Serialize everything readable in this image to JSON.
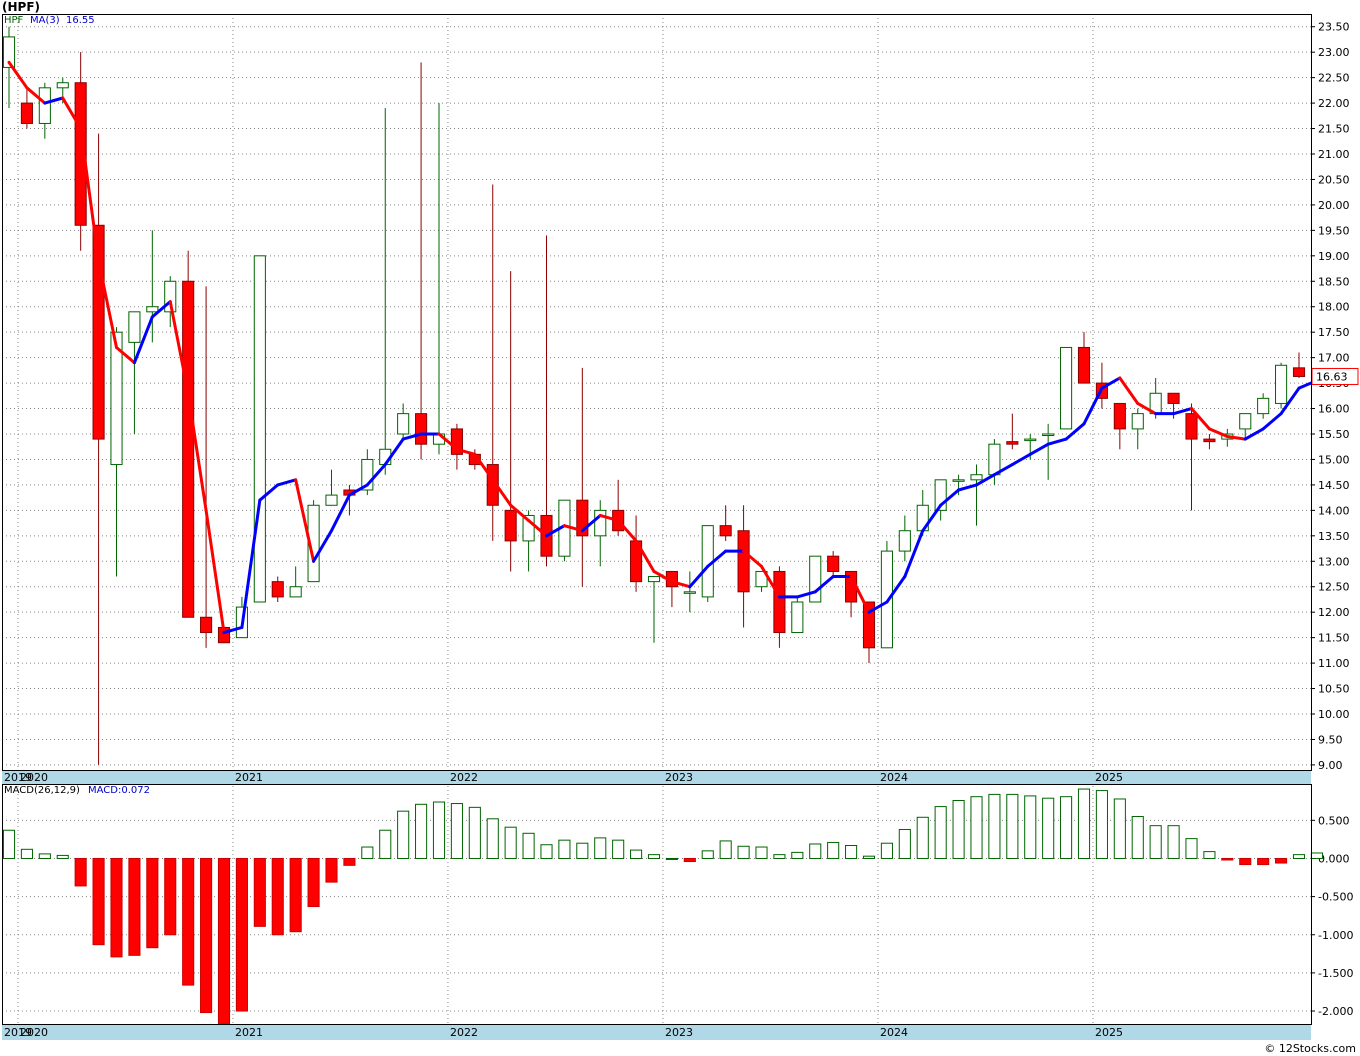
{
  "header": {
    "symbol_title": "(HPF)",
    "price_legend": "HPF",
    "ma_legend": "MA(3)",
    "ma_value": "16.55",
    "macd_legend": "MACD(26,12,9)",
    "macd_value_legend": "MACD:0.072"
  },
  "footer": {
    "credit": "© 12Stocks.com"
  },
  "colors": {
    "up": "#006400",
    "down": "#ff0000",
    "ma_up": "#0000ff",
    "ma_down": "#ff0000",
    "grid": "#888888",
    "axis_band": "#b0d8e6",
    "last_price_box": "#ff0000"
  },
  "chart_data": [
    {
      "type": "candlestick",
      "title": "(HPF)",
      "interval": "monthly",
      "ylim": [
        8.9,
        23.75
      ],
      "yticks": [
        "23.50",
        "23.00",
        "22.50",
        "22.00",
        "21.50",
        "21.00",
        "20.50",
        "20.00",
        "19.50",
        "19.00",
        "18.50",
        "18.00",
        "17.50",
        "17.00",
        "16.50",
        "16.00",
        "15.50",
        "15.00",
        "14.50",
        "14.00",
        "13.50",
        "13.00",
        "12.50",
        "12.00",
        "11.50",
        "11.00",
        "10.50",
        "10.00",
        "9.50",
        "9.00"
      ],
      "x_labels": [
        "2019",
        "2020",
        "2021",
        "2022",
        "2023",
        "2024",
        "2025"
      ],
      "last_price": "16.63",
      "candles": [
        {
          "d": "2019-12",
          "o": 22.7,
          "h": 23.5,
          "l": 21.9,
          "c": 23.3
        },
        {
          "d": "2020-01",
          "o": 22.0,
          "h": 22.3,
          "l": 21.5,
          "c": 21.6
        },
        {
          "d": "2020-02",
          "o": 21.6,
          "h": 22.4,
          "l": 21.3,
          "c": 22.3
        },
        {
          "d": "2020-03",
          "o": 22.3,
          "h": 22.5,
          "l": 22.0,
          "c": 22.4
        },
        {
          "d": "2020-04",
          "o": 22.4,
          "h": 23.0,
          "l": 19.1,
          "c": 19.6
        },
        {
          "d": "2020-05",
          "o": 19.6,
          "h": 21.4,
          "l": 9.0,
          "c": 15.4
        },
        {
          "d": "2020-06",
          "o": 14.9,
          "h": 17.6,
          "l": 12.7,
          "c": 17.5
        },
        {
          "d": "2020-07",
          "o": 17.3,
          "h": 17.9,
          "l": 15.5,
          "c": 17.9
        },
        {
          "d": "2020-08",
          "o": 17.9,
          "h": 19.5,
          "l": 17.3,
          "c": 18.0
        },
        {
          "d": "2020-09",
          "o": 17.9,
          "h": 18.6,
          "l": 17.6,
          "c": 18.5
        },
        {
          "d": "2020-10",
          "o": 18.5,
          "h": 19.1,
          "l": 11.9,
          "c": 11.9
        },
        {
          "d": "2020-11",
          "o": 11.9,
          "h": 18.4,
          "l": 11.3,
          "c": 11.6
        },
        {
          "d": "2020-12",
          "o": 11.7,
          "h": 11.7,
          "l": 11.4,
          "c": 11.4
        },
        {
          "d": "2021-01",
          "o": 11.5,
          "h": 12.3,
          "l": 11.5,
          "c": 12.1
        },
        {
          "d": "2021-02",
          "o": 12.2,
          "h": 19.0,
          "l": 12.2,
          "c": 19.0
        },
        {
          "d": "2021-03",
          "o": 12.6,
          "h": 12.7,
          "l": 12.2,
          "c": 12.3
        },
        {
          "d": "2021-04",
          "o": 12.3,
          "h": 12.9,
          "l": 12.3,
          "c": 12.5
        },
        {
          "d": "2021-05",
          "o": 12.6,
          "h": 14.2,
          "l": 12.6,
          "c": 14.1
        },
        {
          "d": "2021-06",
          "o": 14.1,
          "h": 14.8,
          "l": 14.1,
          "c": 14.3
        },
        {
          "d": "2021-07",
          "o": 14.4,
          "h": 14.5,
          "l": 13.9,
          "c": 14.3
        },
        {
          "d": "2021-08",
          "o": 14.4,
          "h": 15.2,
          "l": 14.3,
          "c": 15.0
        },
        {
          "d": "2021-09",
          "o": 14.9,
          "h": 21.9,
          "l": 14.7,
          "c": 15.2
        },
        {
          "d": "2021-10",
          "o": 15.5,
          "h": 16.1,
          "l": 15.4,
          "c": 15.9
        },
        {
          "d": "2021-11",
          "o": 15.9,
          "h": 22.8,
          "l": 15.0,
          "c": 15.3
        },
        {
          "d": "2021-12",
          "o": 15.3,
          "h": 22.0,
          "l": 15.1,
          "c": 15.5
        },
        {
          "d": "2022-01",
          "o": 15.6,
          "h": 15.7,
          "l": 14.8,
          "c": 15.1
        },
        {
          "d": "2022-02",
          "o": 15.1,
          "h": 15.2,
          "l": 14.8,
          "c": 14.9
        },
        {
          "d": "2022-03",
          "o": 14.9,
          "h": 20.4,
          "l": 13.4,
          "c": 14.1
        },
        {
          "d": "2022-04",
          "o": 14.0,
          "h": 18.7,
          "l": 12.8,
          "c": 13.4
        },
        {
          "d": "2022-05",
          "o": 13.4,
          "h": 14.0,
          "l": 12.8,
          "c": 13.9
        },
        {
          "d": "2022-06",
          "o": 13.9,
          "h": 19.4,
          "l": 12.9,
          "c": 13.1
        },
        {
          "d": "2022-07",
          "o": 13.1,
          "h": 14.2,
          "l": 13.0,
          "c": 14.2
        },
        {
          "d": "2022-08",
          "o": 14.2,
          "h": 16.8,
          "l": 12.5,
          "c": 13.5
        },
        {
          "d": "2022-09",
          "o": 13.5,
          "h": 14.2,
          "l": 12.9,
          "c": 14.0
        },
        {
          "d": "2022-10",
          "o": 14.0,
          "h": 14.6,
          "l": 13.5,
          "c": 13.6
        },
        {
          "d": "2022-11",
          "o": 13.4,
          "h": 13.9,
          "l": 12.4,
          "c": 12.6
        },
        {
          "d": "2022-12",
          "o": 12.6,
          "h": 12.7,
          "l": 11.4,
          "c": 12.7
        },
        {
          "d": "2023-01",
          "o": 12.8,
          "h": 12.8,
          "l": 12.1,
          "c": 12.5
        },
        {
          "d": "2023-02",
          "o": 12.4,
          "h": 12.8,
          "l": 12.0,
          "c": 12.4
        },
        {
          "d": "2023-03",
          "o": 12.3,
          "h": 13.7,
          "l": 12.2,
          "c": 13.7
        },
        {
          "d": "2023-04",
          "o": 13.7,
          "h": 14.1,
          "l": 13.4,
          "c": 13.5
        },
        {
          "d": "2023-05",
          "o": 13.6,
          "h": 14.1,
          "l": 11.7,
          "c": 12.4
        },
        {
          "d": "2023-06",
          "o": 12.5,
          "h": 12.8,
          "l": 12.4,
          "c": 12.8
        },
        {
          "d": "2023-07",
          "o": 12.8,
          "h": 12.9,
          "l": 11.3,
          "c": 11.6
        },
        {
          "d": "2023-08",
          "o": 11.6,
          "h": 12.3,
          "l": 11.7,
          "c": 12.2
        },
        {
          "d": "2023-09",
          "o": 12.2,
          "h": 13.1,
          "l": 12.2,
          "c": 13.1
        },
        {
          "d": "2023-10",
          "o": 13.1,
          "h": 13.2,
          "l": 12.7,
          "c": 12.8
        },
        {
          "d": "2023-11",
          "o": 12.8,
          "h": 12.8,
          "l": 11.9,
          "c": 12.2
        },
        {
          "d": "2023-12",
          "o": 12.2,
          "h": 12.2,
          "l": 11.0,
          "c": 11.3
        },
        {
          "d": "2024-01",
          "o": 11.3,
          "h": 13.4,
          "l": 11.3,
          "c": 13.2
        },
        {
          "d": "2024-02",
          "o": 13.2,
          "h": 13.9,
          "l": 13.0,
          "c": 13.6
        },
        {
          "d": "2024-03",
          "o": 13.6,
          "h": 14.4,
          "l": 13.5,
          "c": 14.1
        },
        {
          "d": "2024-04",
          "o": 14.0,
          "h": 14.6,
          "l": 13.8,
          "c": 14.6
        },
        {
          "d": "2024-05",
          "o": 14.6,
          "h": 14.7,
          "l": 14.3,
          "c": 14.6
        },
        {
          "d": "2024-06",
          "o": 14.6,
          "h": 14.9,
          "l": 13.7,
          "c": 14.7
        },
        {
          "d": "2024-07",
          "o": 14.7,
          "h": 15.4,
          "l": 14.5,
          "c": 15.3
        },
        {
          "d": "2024-08",
          "o": 15.35,
          "h": 15.9,
          "l": 15.2,
          "c": 15.3
        },
        {
          "d": "2024-09",
          "o": 15.4,
          "h": 15.5,
          "l": 15.0,
          "c": 15.4
        },
        {
          "d": "2024-10",
          "o": 15.5,
          "h": 15.7,
          "l": 14.6,
          "c": 15.5
        },
        {
          "d": "2024-11",
          "o": 15.6,
          "h": 17.2,
          "l": 15.6,
          "c": 17.2
        },
        {
          "d": "2024-12",
          "o": 17.2,
          "h": 17.5,
          "l": 16.5,
          "c": 16.5
        },
        {
          "d": "2025-01",
          "o": 16.5,
          "h": 16.9,
          "l": 16.0,
          "c": 16.2
        },
        {
          "d": "2025-02",
          "o": 16.1,
          "h": 16.1,
          "l": 15.2,
          "c": 15.6
        },
        {
          "d": "2025-03",
          "o": 15.6,
          "h": 16.0,
          "l": 15.2,
          "c": 15.9
        },
        {
          "d": "2025-04",
          "o": 15.9,
          "h": 16.6,
          "l": 15.8,
          "c": 16.3
        },
        {
          "d": "2025-05",
          "o": 16.3,
          "h": 16.3,
          "l": 15.8,
          "c": 16.1
        },
        {
          "d": "2025-06",
          "o": 15.9,
          "h": 16.1,
          "l": 14.0,
          "c": 15.4
        },
        {
          "d": "2025-07",
          "o": 15.4,
          "h": 15.5,
          "l": 15.2,
          "c": 15.35
        },
        {
          "d": "2025-08",
          "o": 15.4,
          "h": 15.6,
          "l": 15.25,
          "c": 15.5
        },
        {
          "d": "2025-09",
          "o": 15.6,
          "h": 15.9,
          "l": 15.4,
          "c": 15.9
        },
        {
          "d": "2025-10",
          "o": 15.9,
          "h": 16.3,
          "l": 15.8,
          "c": 16.2
        },
        {
          "d": "2025-11",
          "o": 16.1,
          "h": 16.9,
          "l": 16.0,
          "c": 16.85
        },
        {
          "d": "2025-12",
          "o": 16.8,
          "h": 17.1,
          "l": 16.6,
          "c": 16.63
        }
      ],
      "series": [
        {
          "name": "MA(3)",
          "values": [
            22.8,
            22.3,
            22.0,
            22.1,
            21.5,
            18.9,
            17.2,
            16.9,
            17.8,
            18.1,
            16.3,
            14.0,
            11.6,
            11.7,
            14.2,
            14.5,
            14.6,
            13.0,
            13.6,
            14.3,
            14.5,
            14.9,
            15.4,
            15.5,
            15.5,
            15.2,
            15.1,
            14.6,
            14.1,
            13.8,
            13.5,
            13.7,
            13.6,
            13.9,
            13.8,
            13.4,
            12.8,
            12.6,
            12.5,
            12.9,
            13.2,
            13.2,
            12.9,
            12.3,
            12.3,
            12.4,
            12.7,
            12.7,
            12.0,
            12.2,
            12.7,
            13.6,
            14.1,
            14.4,
            14.5,
            14.7,
            14.9,
            15.1,
            15.3,
            15.4,
            15.7,
            16.4,
            16.6,
            16.1,
            15.9,
            15.9,
            16.0,
            15.6,
            15.45,
            15.4,
            15.6,
            15.9,
            16.4,
            16.55
          ]
        }
      ]
    },
    {
      "type": "bar",
      "title": "MACD(26,12,9)",
      "ylim": [
        -2.17,
        0.95
      ],
      "yticks": [
        "0.500",
        "0.000",
        "-0.500",
        "-1.000",
        "-1.500",
        "-2.000"
      ],
      "x_labels": [
        "2019",
        "2020",
        "2021",
        "2022",
        "2023",
        "2024",
        "2025"
      ],
      "series": [
        {
          "name": "MACD",
          "values": [
            0.37,
            0.12,
            0.06,
            0.04,
            -0.36,
            -1.13,
            -1.29,
            -1.27,
            -1.17,
            -1.0,
            -1.66,
            -2.02,
            -2.17,
            -2.0,
            -0.89,
            -1.0,
            -0.96,
            -0.63,
            -0.31,
            -0.09,
            0.15,
            0.37,
            0.62,
            0.71,
            0.74,
            0.72,
            0.67,
            0.52,
            0.41,
            0.33,
            0.18,
            0.24,
            0.2,
            0.27,
            0.24,
            0.11,
            0.05,
            0.0,
            -0.04,
            0.1,
            0.23,
            0.16,
            0.15,
            0.05,
            0.08,
            0.19,
            0.21,
            0.17,
            0.03,
            0.2,
            0.38,
            0.54,
            0.68,
            0.76,
            0.81,
            0.84,
            0.84,
            0.82,
            0.79,
            0.81,
            0.91,
            0.89,
            0.78,
            0.55,
            0.43,
            0.43,
            0.26,
            0.09,
            -0.02,
            -0.08,
            -0.08,
            -0.06,
            0.05,
            0.072
          ]
        }
      ]
    }
  ]
}
